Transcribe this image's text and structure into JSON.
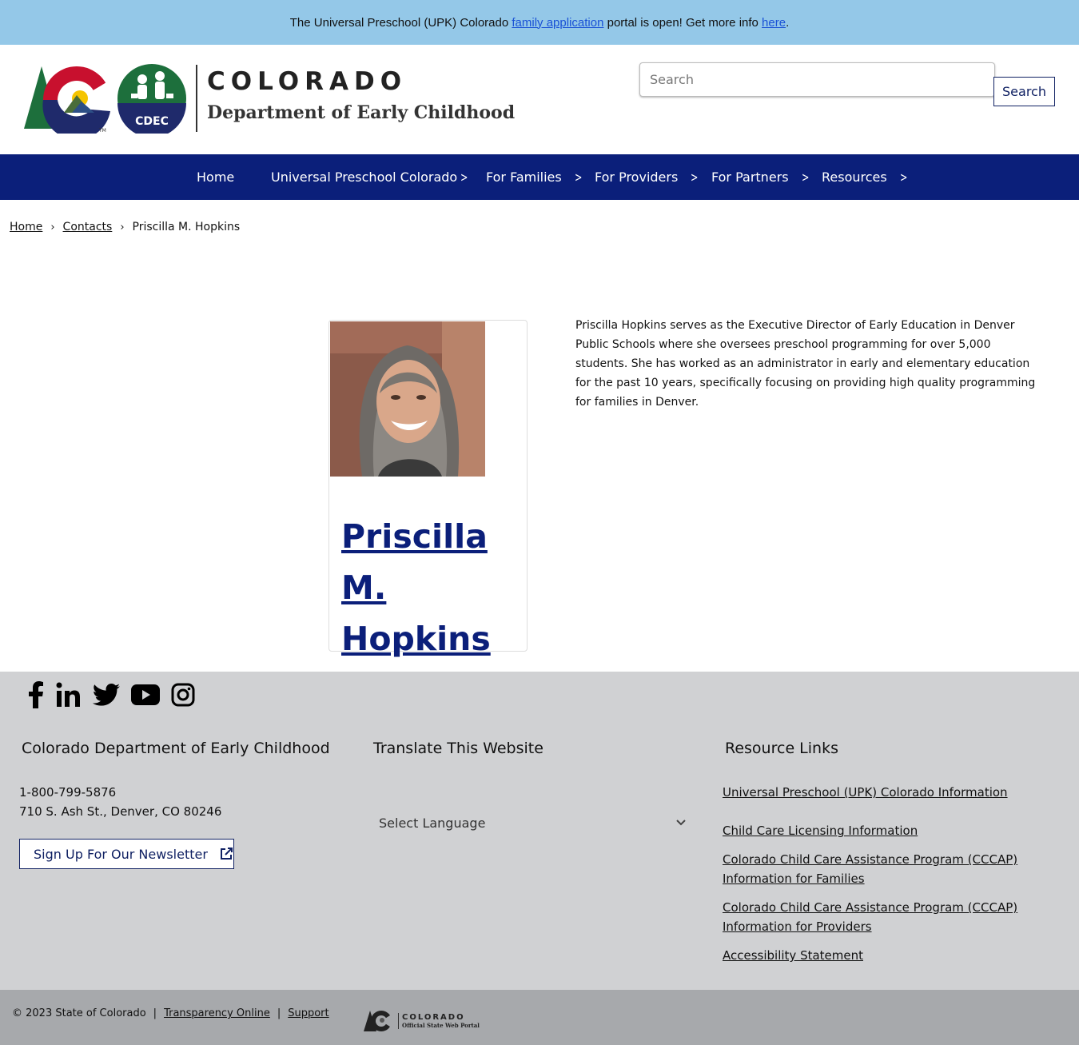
{
  "alert": {
    "text_before": "The Universal Preschool (UPK) Colorado ",
    "link1": "family application",
    "text_middle": " portal is open! Get more info ",
    "link2": "here",
    "text_after": "."
  },
  "header": {
    "brand_title": "COLORADO",
    "brand_subtitle": "Department of Early Childhood",
    "badge_text": "CDEC",
    "search_placeholder": "Search",
    "search_button": "Search"
  },
  "nav": {
    "items": [
      {
        "label": "Home"
      },
      {
        "label": "Universal Preschool Colorado"
      },
      {
        "label": "For Families"
      },
      {
        "label": "For Providers"
      },
      {
        "label": "For Partners"
      },
      {
        "label": "Resources"
      }
    ]
  },
  "breadcrumb": {
    "items": [
      "Home",
      "Contacts",
      "Priscilla M. Hopkins"
    ]
  },
  "profile": {
    "name": "Priscilla M. Hopkins",
    "bio": "Priscilla Hopkins serves as the Executive Director of Early Education in Denver Public Schools where she oversees preschool programming for over 5,000 students. She has worked as an administrator in early and elementary education for the past 10 years, specifically focusing on providing high quality programming for families in Denver."
  },
  "footer": {
    "social_icons": [
      "facebook-icon",
      "linkedin-icon",
      "twitter-icon",
      "youtube-icon",
      "instagram-icon"
    ],
    "col1": {
      "title": "Colorado Department of Early Childhood",
      "phone": "1-800-799-5876",
      "address": "710 S. Ash St., Denver, CO 80246",
      "newsletter": "Sign Up For Our Newsletter"
    },
    "col2": {
      "title": "Translate This Website",
      "select_label": "Select Language"
    },
    "col3": {
      "title": "Resource Links",
      "links": [
        "Universal Preschool (UPK) Colorado Information",
        "Child Care Licensing Information",
        "Colorado Child Care Assistance Program (CCCAP) Information for Families",
        "Colorado Child Care Assistance Program (CCCAP) Information for Providers",
        "Accessibility Statement"
      ]
    }
  },
  "bottom": {
    "copyright": "© 2023 State of Colorado",
    "transparency": "Transparency Online",
    "support": "Support",
    "pipe": "|",
    "state_logo_title": "COLORADO",
    "state_logo_sub": "Official State Web Portal"
  },
  "colors": {
    "alert_bg": "#94c8e8",
    "nav_bg": "#0b1f7a",
    "footer_bg": "#d0d1d3",
    "bottom_bg": "#a7a9ac",
    "accent": "#102163"
  }
}
